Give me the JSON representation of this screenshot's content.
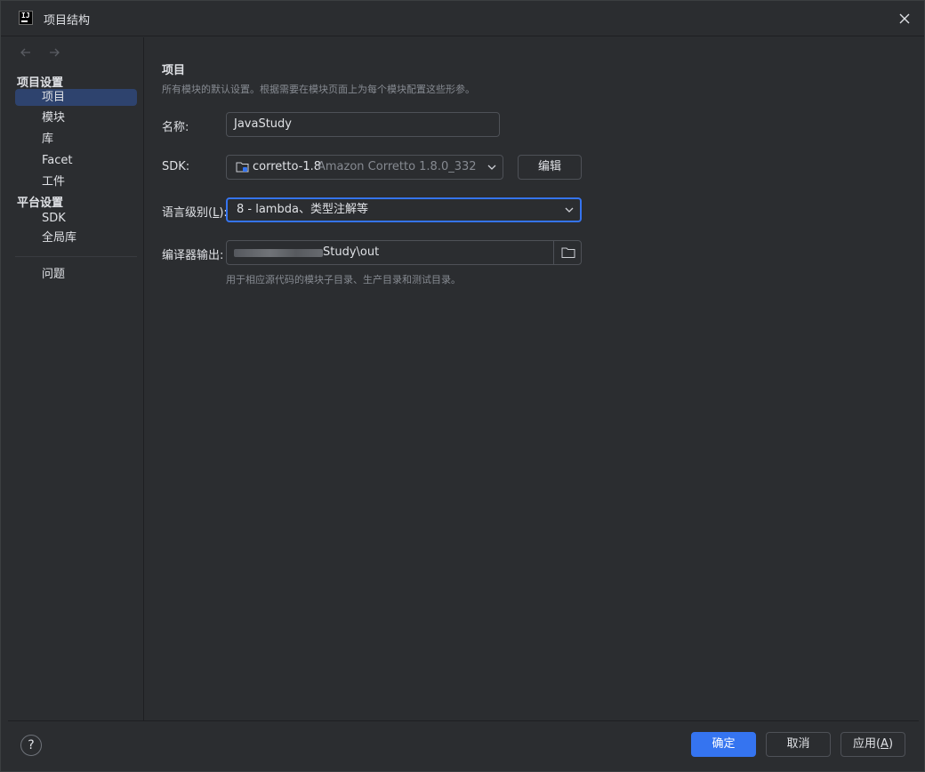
{
  "window": {
    "title": "项目结构",
    "icon": "intellij-app-icon",
    "app_icon_text": "IJ"
  },
  "sidebar": {
    "back_icon": "arrow-left-icon",
    "forward_icon": "arrow-right-icon",
    "project_settings_header": "项目设置",
    "platform_settings_header": "平台设置",
    "items": {
      "project": "项目",
      "modules": "模块",
      "libraries": "库",
      "facets": "Facet",
      "artifacts": "工件",
      "sdks": "SDK",
      "global_libraries": "全局库",
      "problems": "问题"
    },
    "selected": "项目"
  },
  "main": {
    "title": "项目",
    "description": "所有模块的默认设置。根据需要在模块页面上为每个模块配置这些形参。",
    "name_label": "名称:",
    "name_value": "JavaStudy",
    "sdk_label": "SDK:",
    "sdk_name": "corretto-1.8",
    "sdk_version": "Amazon Corretto 1.8.0_332",
    "edit_button": "编辑",
    "language_level_label_prefix": "语言级别(",
    "language_level_label_mnemonic": "L",
    "language_level_label_suffix": "):",
    "language_level_value": "8 - lambda、类型注解等",
    "compiler_output_label": "编译器输出:",
    "compiler_output_value": "Study\\out",
    "compiler_output_hint": "用于相应源代码的模块子目录、生产目录和测试目录。"
  },
  "footer": {
    "help": "?",
    "ok": "确定",
    "cancel": "取消",
    "apply_prefix": "应用(",
    "apply_mnemonic": "A",
    "apply_suffix": ")"
  },
  "colors": {
    "accent": "#3574f0",
    "selection": "#2e436e",
    "background": "#2b2d30"
  }
}
